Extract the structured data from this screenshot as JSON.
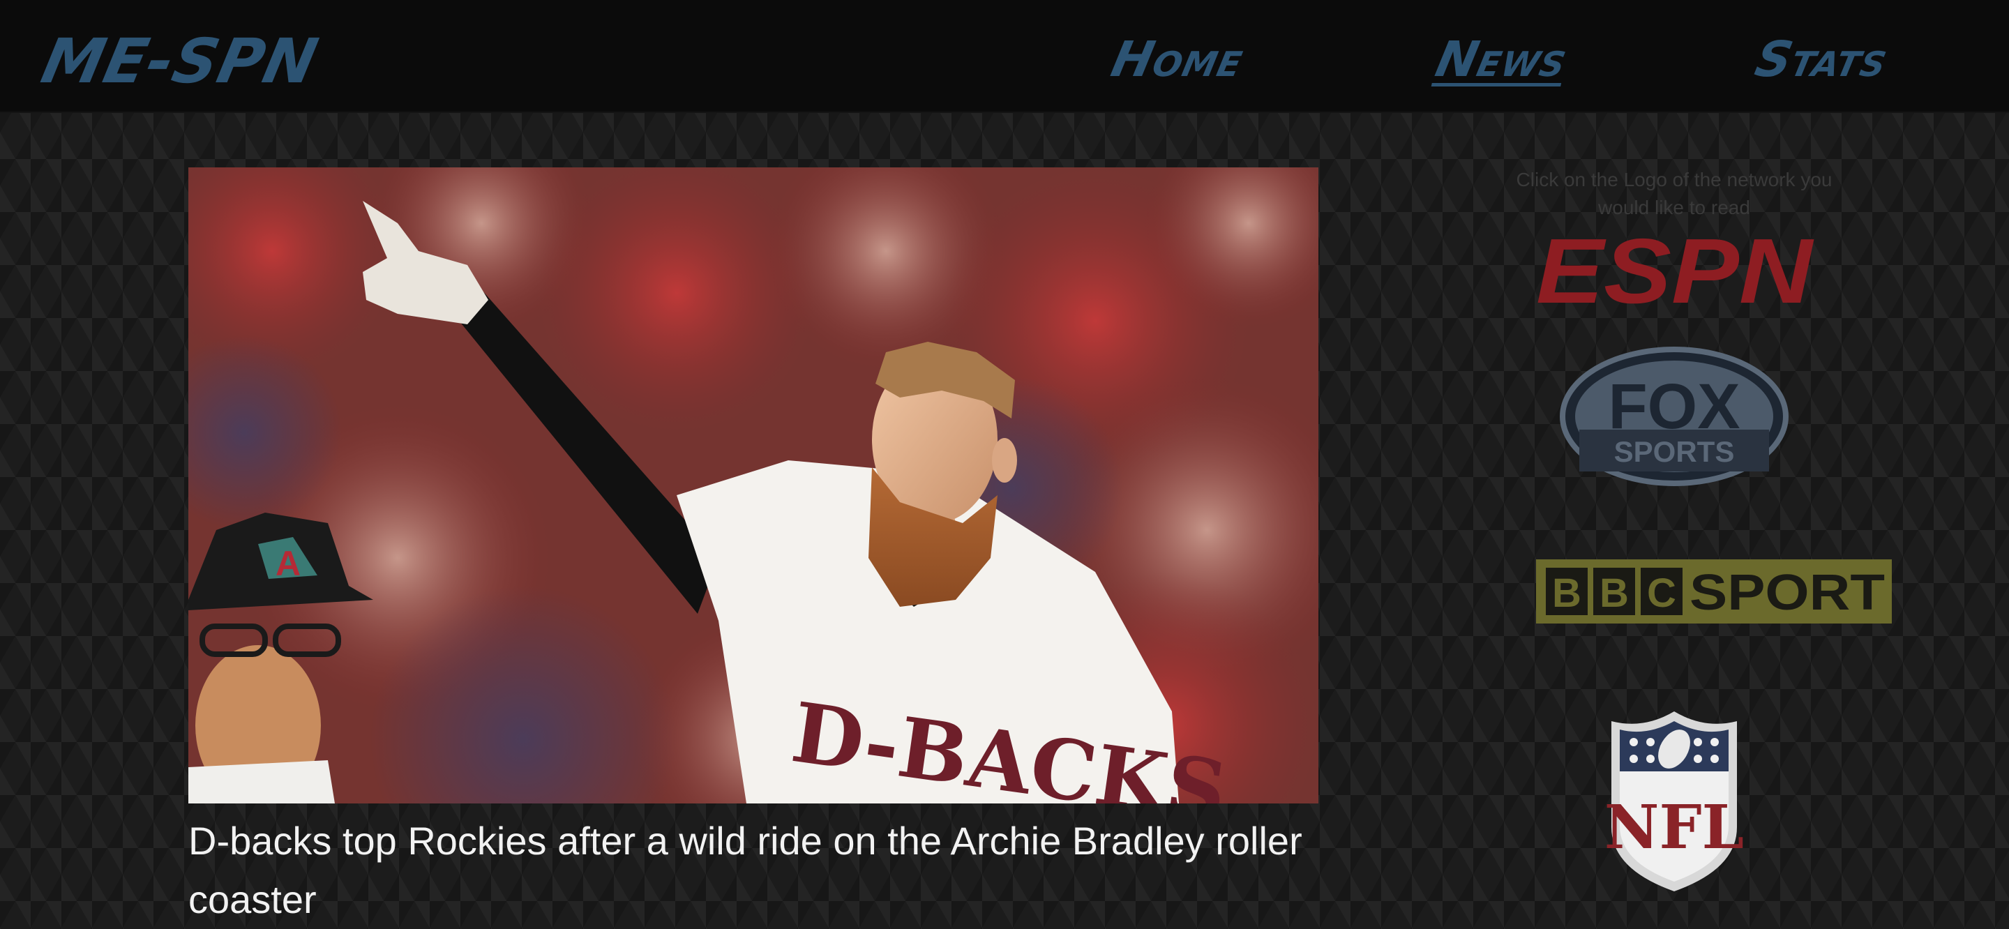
{
  "nav": {
    "brand": "ME-SPN",
    "links": [
      {
        "label": "Home",
        "active": false
      },
      {
        "label": "News",
        "active": true
      },
      {
        "label": "Stats",
        "active": false
      }
    ]
  },
  "article": {
    "title": "D-backs top Rockies after a wild ride on the Archie Bradley roller coaster",
    "image_icon": "baseball-player-photo",
    "jersey_text": "D-BACKS",
    "helmet_letter": "A"
  },
  "sidebar": {
    "hint": "Click on the Logo of the network you would like to read",
    "logos": [
      {
        "name": "espn-logo",
        "text": "ESPN",
        "color": "#8e1d22"
      },
      {
        "name": "fox-sports-logo",
        "text_top": "FOX",
        "text_bottom": "SPORTS",
        "color": "#4c5a6a"
      },
      {
        "name": "bbc-sport-logo",
        "letters": [
          "B",
          "B",
          "C"
        ],
        "text": "SPORT",
        "color": "#6b6a2c"
      },
      {
        "name": "nfl-logo",
        "text": "NFL",
        "color": "#8a2328"
      }
    ]
  },
  "colors": {
    "nav_text": "#2c5373",
    "page_bg": "#1c1c1c",
    "navbar_bg": "#0b0b0b"
  }
}
